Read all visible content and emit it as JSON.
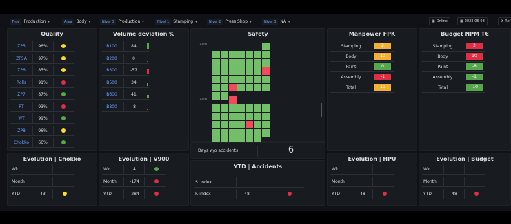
{
  "filters": [
    {
      "label": "Type",
      "value": "Production"
    },
    {
      "label": "Area",
      "value": "Body"
    },
    {
      "label": "Nivel 0",
      "value": "Production"
    },
    {
      "label": "Nivel 1",
      "value": "Stamping"
    },
    {
      "label": "Nivel 2",
      "value": "Press Shop"
    },
    {
      "label": "Nivel 3",
      "value": "NA"
    }
  ],
  "toolbar": {
    "online_label": "Online",
    "date_label": "2023-06-08",
    "refresh_label": "Ref"
  },
  "quality": {
    "title": "Quality",
    "rows": [
      {
        "name": "ZP5",
        "value": "96%",
        "status": "yellow"
      },
      {
        "name": "ZP5A",
        "value": "97%",
        "status": "yellow"
      },
      {
        "name": "ZP6",
        "value": "85%",
        "status": "yellow"
      },
      {
        "name": "Rolls",
        "value": "91%",
        "status": "red"
      },
      {
        "name": "ZP7",
        "value": "87%",
        "status": "green"
      },
      {
        "name": "RT",
        "value": "93%",
        "status": "red"
      },
      {
        "name": "WT",
        "value": "99%",
        "status": "green"
      },
      {
        "name": "ZP8",
        "value": "96%",
        "status": "yellow"
      },
      {
        "name": "Chokko",
        "value": "66%",
        "status": "green"
      }
    ]
  },
  "volume": {
    "title": "Volume deviation %",
    "rows": [
      {
        "name": "B100",
        "value": "84",
        "bar": 84
      },
      {
        "name": "B200",
        "value": "0",
        "bar": 0
      },
      {
        "name": "B300",
        "value": "-57",
        "bar": -57
      },
      {
        "name": "B500",
        "value": "34",
        "bar": 34
      },
      {
        "name": "B600",
        "value": "41",
        "bar": 41
      },
      {
        "name": "B800",
        "value": "-8",
        "bar": -8
      }
    ]
  },
  "safety": {
    "title": "Safety",
    "month1_label": "23/01",
    "month2_label": "23/02",
    "days_label": "Days w/o accidents",
    "days_value": "6"
  },
  "manpower": {
    "title": "Manpower FPK",
    "rows": [
      {
        "name": "Stamping",
        "value": "2",
        "status": "yellow"
      },
      {
        "name": "Body",
        "value": "10",
        "status": "yellow"
      },
      {
        "name": "Paint",
        "value": "0",
        "status": "green"
      },
      {
        "name": "Assembly",
        "value": "-1",
        "status": "red"
      },
      {
        "name": "Total",
        "value": "10",
        "status": "yellow"
      }
    ]
  },
  "budget": {
    "title": "Budget NPM T€",
    "rows": [
      {
        "name": "Stamping",
        "value": "2",
        "status": "red"
      },
      {
        "name": "Body",
        "value": "10",
        "status": "red"
      },
      {
        "name": "Paint",
        "value": "-8",
        "status": "green"
      },
      {
        "name": "Assembly",
        "value": "-1",
        "status": "green"
      },
      {
        "name": "Total",
        "value": "-10",
        "status": "green"
      }
    ]
  },
  "evo_chokko": {
    "title": "Evolution | Chokko",
    "rows": [
      {
        "name": "Wk",
        "value": "",
        "status": ""
      },
      {
        "name": "Month",
        "value": "",
        "status": ""
      },
      {
        "name": "YTD",
        "value": "43",
        "status": "yellow"
      }
    ]
  },
  "evo_v900": {
    "title": "Evolution | V900",
    "rows": [
      {
        "name": "Wk",
        "value": "4",
        "status": "green"
      },
      {
        "name": "Month",
        "value": "-174",
        "status": "red"
      },
      {
        "name": "YTD",
        "value": "-284",
        "status": "red"
      }
    ]
  },
  "ytd_accidents": {
    "title": "YTD | Accidents",
    "rows": [
      {
        "name": "S. index",
        "value": "",
        "status": ""
      },
      {
        "name": "F. index",
        "value": "48",
        "status": "red"
      }
    ]
  },
  "evo_hpu": {
    "title": "Evolution | HPU",
    "rows": [
      {
        "name": "Wk",
        "value": "",
        "status": ""
      },
      {
        "name": "Month",
        "value": "",
        "status": ""
      },
      {
        "name": "YTD",
        "value": "48",
        "status": "red"
      }
    ]
  },
  "evo_budget": {
    "title": "Evolution | Budget",
    "rows": [
      {
        "name": "Wk",
        "value": "",
        "status": ""
      },
      {
        "name": "Month",
        "value": "",
        "status": ""
      },
      {
        "name": "YTD",
        "value": "48",
        "status": "red"
      }
    ]
  },
  "colors": {
    "yellow": "#fade2a",
    "green": "#56a64b",
    "red": "#e02f44",
    "orange": "#f2b134",
    "grid_green": "#73bf69",
    "grid_red": "#f2495c"
  }
}
